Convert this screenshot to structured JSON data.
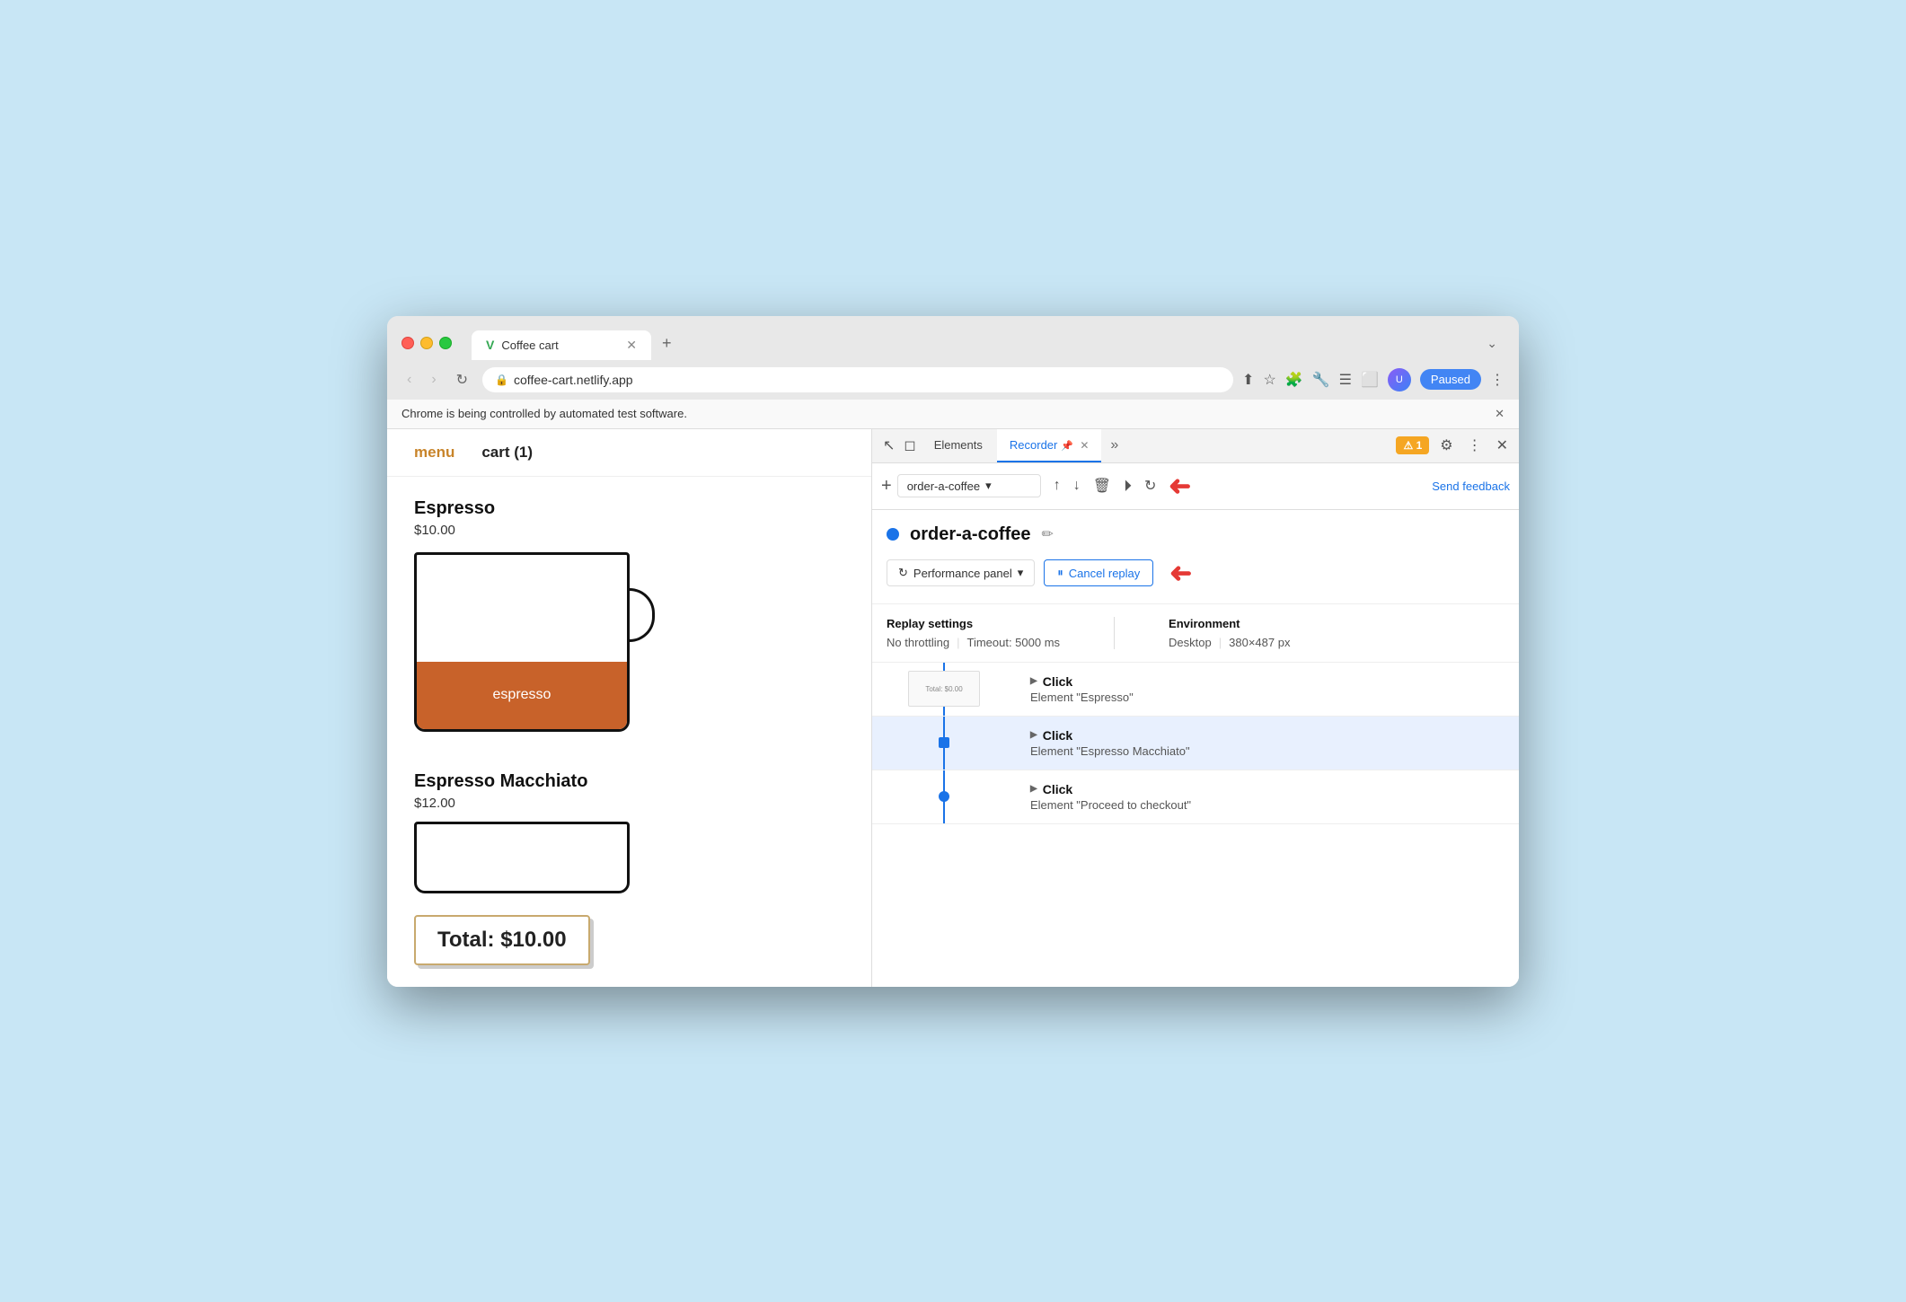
{
  "browser": {
    "tab_title": "Coffee cart",
    "tab_icon": "V",
    "url": "coffee-cart.netlify.app",
    "paused_label": "Paused",
    "new_tab_symbol": "+",
    "expand_symbol": "⌄"
  },
  "automation_banner": {
    "text": "Chrome is being controlled by automated test software.",
    "close_symbol": "✕"
  },
  "webpage": {
    "nav_menu": "menu",
    "nav_cart": "cart (1)",
    "product1_name": "Espresso",
    "product1_price": "$10.00",
    "product1_liquid_label": "espresso",
    "product2_name": "Espresso Macchiato",
    "product2_price": "$12.00",
    "total_label": "Total: $10.00"
  },
  "devtools": {
    "tabs": [
      {
        "label": "Elements",
        "active": false
      },
      {
        "label": "Recorder",
        "active": true
      },
      {
        "label": "»",
        "active": false
      }
    ],
    "badge_count": "1",
    "close_symbol": "✕",
    "more_symbol": "⋮",
    "gear_symbol": "⚙"
  },
  "recorder_toolbar": {
    "add_symbol": "+",
    "recording_name": "order-a-coffee",
    "dropdown_symbol": "▾",
    "send_feedback_label": "Send feedback",
    "icons": {
      "export": "↑",
      "import": "↓",
      "delete": "🗑",
      "play": "⏵",
      "replay": "↻"
    }
  },
  "recording": {
    "title": "order-a-coffee",
    "edit_icon": "✏",
    "performance_panel_label": "Performance panel",
    "performance_icon": "↻",
    "dropdown_symbol": "▾",
    "cancel_replay_label": "Cancel replay",
    "cancel_replay_icon": "⏸"
  },
  "replay_settings": {
    "left_label": "Replay settings",
    "throttling_label": "No throttling",
    "timeout_label": "Timeout: 5000 ms",
    "right_label": "Environment",
    "environment_label": "Desktop",
    "viewport_label": "380×487 px"
  },
  "timeline": {
    "items": [
      {
        "action": "Click",
        "target": "Element \"Espresso\"",
        "has_screenshot": true,
        "screenshot_text": "Total: $0.00",
        "active": false
      },
      {
        "action": "Click",
        "target": "Element \"Espresso Macchiato\"",
        "has_screenshot": false,
        "active": true
      },
      {
        "action": "Click",
        "target": "Element \"Proceed to checkout\"",
        "has_screenshot": false,
        "active": false
      }
    ]
  }
}
